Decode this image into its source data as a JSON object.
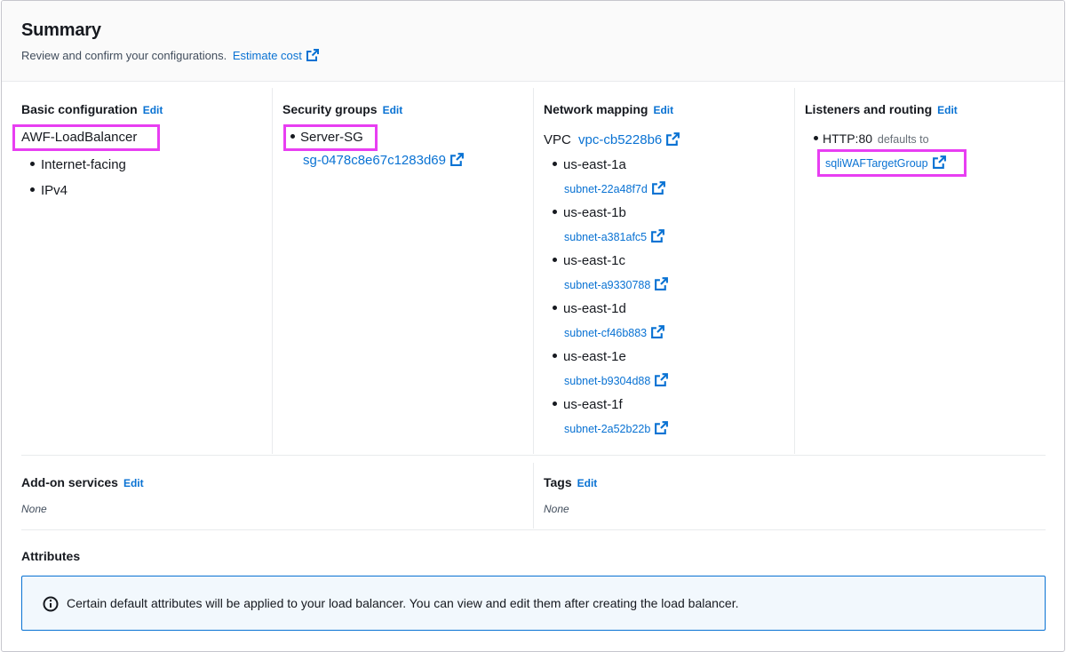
{
  "summary": {
    "title": "Summary",
    "subtitle": "Review and confirm your configurations.",
    "estimate_cost": "Estimate cost"
  },
  "edit_label": "Edit",
  "basic_configuration": {
    "title": "Basic configuration",
    "name": "AWF-LoadBalancer",
    "scheme": "Internet-facing",
    "ip_type": "IPv4"
  },
  "security_groups": {
    "title": "Security groups",
    "group_name": "Server-SG",
    "group_id": "sg-0478c8e67c1283d69"
  },
  "network_mapping": {
    "title": "Network mapping",
    "vpc_label": "VPC",
    "vpc_id": "vpc-cb5228b6",
    "zones": [
      {
        "az": "us-east-1a",
        "subnet": "subnet-22a48f7d"
      },
      {
        "az": "us-east-1b",
        "subnet": "subnet-a381afc5"
      },
      {
        "az": "us-east-1c",
        "subnet": "subnet-a9330788"
      },
      {
        "az": "us-east-1d",
        "subnet": "subnet-cf46b883"
      },
      {
        "az": "us-east-1e",
        "subnet": "subnet-b9304d88"
      },
      {
        "az": "us-east-1f",
        "subnet": "subnet-2a52b22b"
      }
    ]
  },
  "listeners": {
    "title": "Listeners and routing",
    "listener": "HTTP:80",
    "defaults_to": "defaults to",
    "target_group": "sqliWAFTargetGroup"
  },
  "addon_services": {
    "title": "Add-on services",
    "value": "None"
  },
  "tags": {
    "title": "Tags",
    "value": "None"
  },
  "attributes": {
    "title": "Attributes",
    "info_text": "Certain default attributes will be applied to your load balancer. You can view and edit them after creating the load balancer."
  },
  "colors": {
    "link": "#0972d3",
    "highlight": "#e83ef2",
    "text": "#16191f"
  }
}
